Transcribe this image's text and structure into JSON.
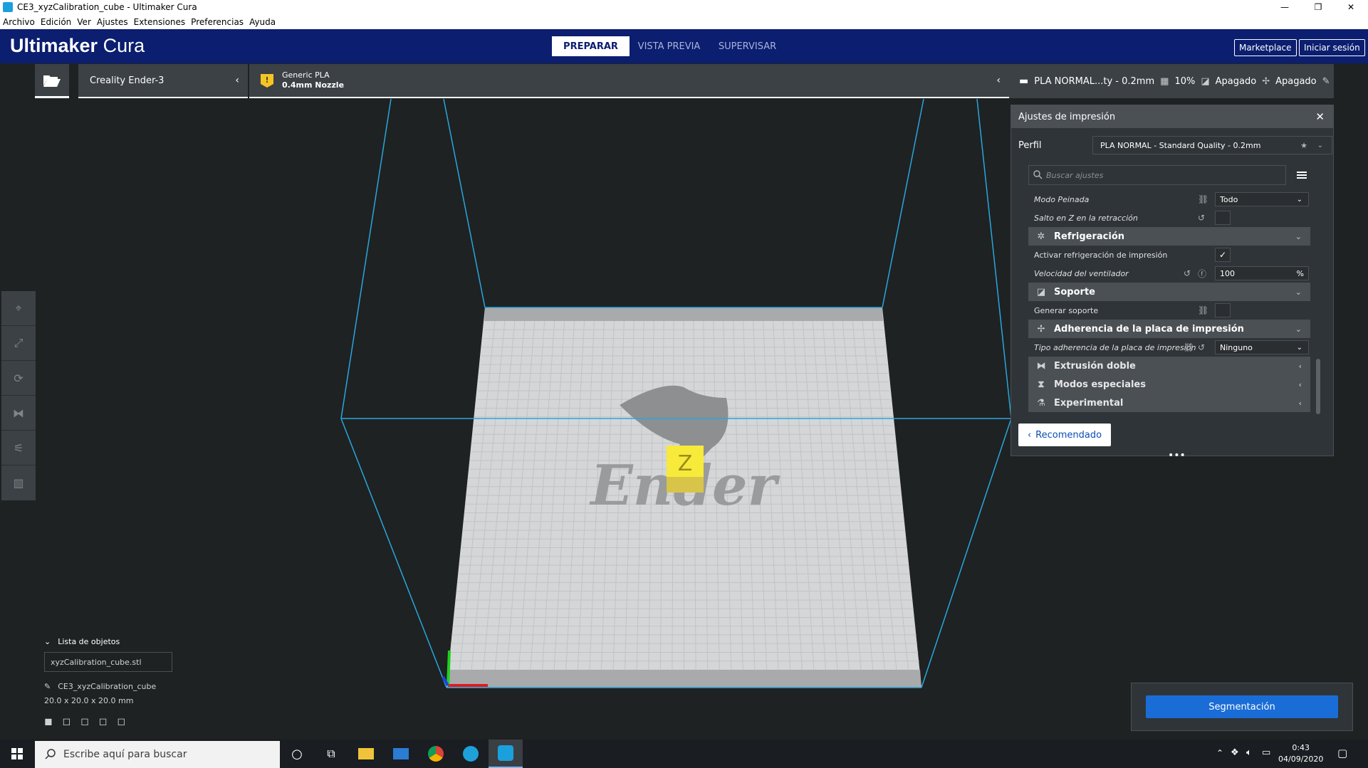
{
  "window": {
    "title": "CE3_xyzCalibration_cube - Ultimaker Cura",
    "minimize": "—",
    "restore": "❐",
    "close": "✕"
  },
  "menu": [
    "Archivo",
    "Edición",
    "Ver",
    "Ajustes",
    "Extensiones",
    "Preferencias",
    "Ayuda"
  ],
  "header": {
    "logo_bold": "Ultimaker",
    "logo_light": " Cura",
    "stages": [
      {
        "label": "PREPARAR",
        "active": true
      },
      {
        "label": "VISTA PREVIA",
        "active": false
      },
      {
        "label": "SUPERVISAR",
        "active": false
      }
    ],
    "marketplace": "Marketplace",
    "signin": "Iniciar sesión"
  },
  "toolbar": {
    "printer": "Creality Ender-3",
    "material_name": "Generic PLA",
    "nozzle": "0.4mm Nozzle",
    "profile_short": "PLA NORMAL...ty - 0.2mm",
    "infill": "10%",
    "support": "Apagado",
    "adhesion": "Apagado"
  },
  "settings": {
    "title": "Ajustes de impresión",
    "profile_label": "Perfil",
    "profile_value": "PLA NORMAL - Standard Quality - 0.2mm",
    "search_placeholder": "Buscar ajustes",
    "rows": {
      "combing": {
        "label": "Modo Peinada",
        "value": "Todo"
      },
      "zhop": {
        "label": "Salto en Z en la retracción"
      },
      "cat_cooling": "Refrigeración",
      "enable_cooling": {
        "label": "Activar refrigeración de impresión"
      },
      "fan_speed": {
        "label": "Velocidad del ventilador",
        "value": "100",
        "unit": "%"
      },
      "cat_support": "Soporte",
      "gen_support": {
        "label": "Generar soporte"
      },
      "cat_adhesion": "Adherencia de la placa de impresión",
      "adhesion_type": {
        "label": "Tipo adherencia de la placa de impresión",
        "value": "Ninguno"
      },
      "cat_dual": "Extrusión doble",
      "cat_special": "Modos especiales",
      "cat_experimental": "Experimental"
    },
    "recommended": "Recomendado"
  },
  "objects": {
    "title": "Lista de objetos",
    "file": "xyzCalibration_cube.stl",
    "name": "CE3_xyzCalibration_cube",
    "dims": "20.0 x 20.0 x 20.0 mm"
  },
  "slice_button": "Segmentación",
  "bed_logo": "Ender",
  "taskbar": {
    "search": "Escribe aquí para buscar",
    "time": "0:43",
    "date": "04/09/2020"
  }
}
